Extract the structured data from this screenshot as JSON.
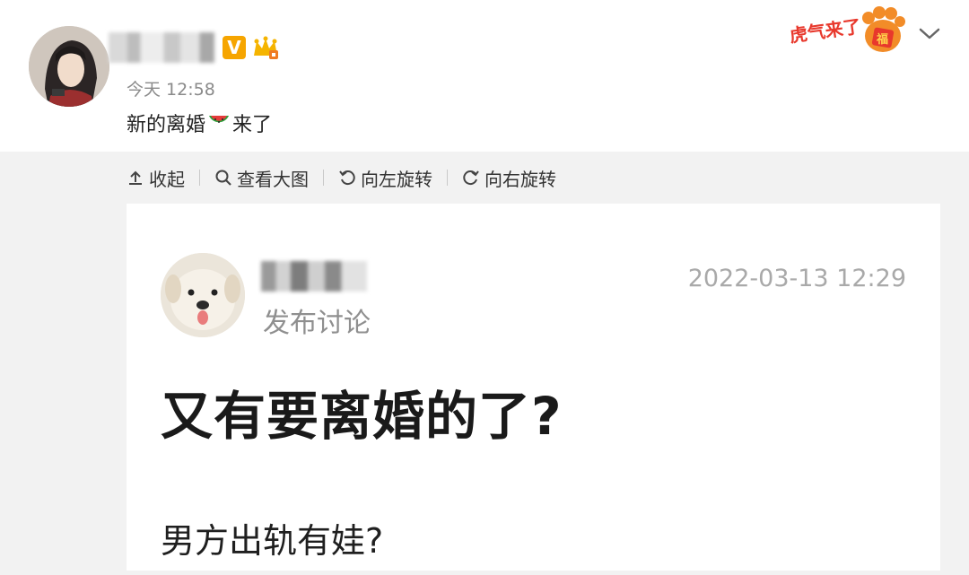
{
  "post": {
    "timestamp": "今天 12:58",
    "text_before": "新的离婚",
    "emoji": "🍉",
    "text_after": "来了",
    "verified_badge": "V",
    "icons": [
      "avatar",
      "verified-badge",
      "crown-icon",
      "tiger-new-year-sticker",
      "chevron-down-icon",
      "watermelon-icon"
    ]
  },
  "toolbar": {
    "collapse": "收起",
    "view_large": "查看大图",
    "rotate_left": "向左旋转",
    "rotate_right": "向右旋转"
  },
  "screenshot": {
    "subtitle": "发布讨论",
    "date": "2022-03-13 12:29",
    "title": "又有要离婚的了?",
    "line1": "男方出轨有娃?"
  },
  "colors": {
    "badge": "#f6a500",
    "tiger_red": "#e8382c",
    "gray_area": "#f2f2f2"
  }
}
